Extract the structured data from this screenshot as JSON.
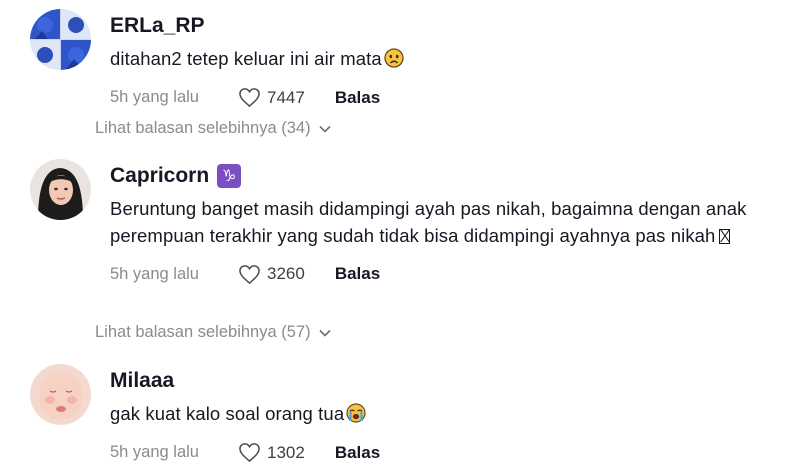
{
  "comments": [
    {
      "username": "ERLa_RP",
      "text": "ditahan2 tetep keluar ini air mata",
      "emoji": "worried-face-emoji",
      "time": "5h yang lalu",
      "likes": "7447",
      "reply_label": "Balas",
      "more_replies": "Lihat balasan selebihnya (34)"
    },
    {
      "username": "Capricorn",
      "badge": "♑",
      "text": "Beruntung banget masih didampingi ayah pas nikah, bagaimna dengan anak perempuan terakhir yang sudah tidak bisa didampingi ayahnya pas nikah",
      "time": "5h yang lalu",
      "likes": "3260",
      "reply_label": "Balas",
      "more_replies": "Lihat balasan selebihnya (57)"
    },
    {
      "username": "Milaaa",
      "text": "gak kuat kalo soal orang tua",
      "emoji": "loudly-crying-face-emoji",
      "time": "5h yang lalu",
      "likes": "1302",
      "reply_label": "Balas"
    }
  ],
  "colors": {
    "text": "#161823",
    "muted": "#8a8b91",
    "zodiac": "#7b4fc4"
  }
}
